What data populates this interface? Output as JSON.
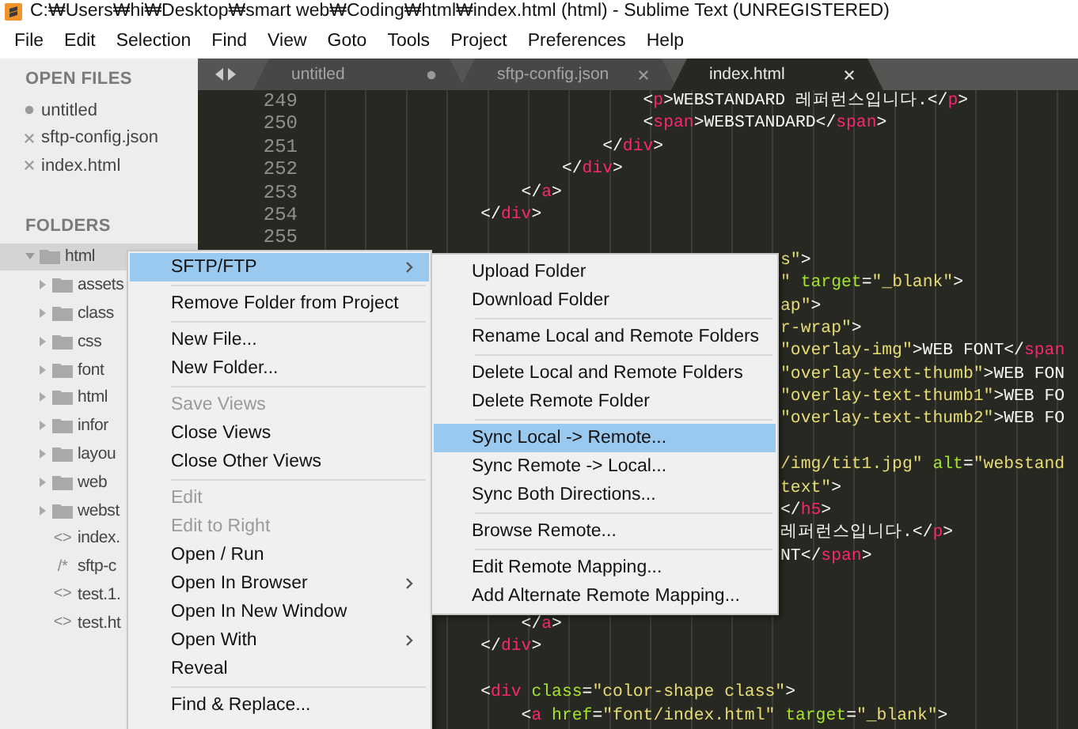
{
  "window": {
    "title": "C:₩Users₩hi₩Desktop₩smart web₩Coding₩html₩index.html (html) - Sublime Text (UNREGISTERED)"
  },
  "menu_bar": [
    {
      "label": "File"
    },
    {
      "label": "Edit"
    },
    {
      "label": "Selection"
    },
    {
      "label": "Find"
    },
    {
      "label": "View"
    },
    {
      "label": "Goto"
    },
    {
      "label": "Tools"
    },
    {
      "label": "Project"
    },
    {
      "label": "Preferences"
    },
    {
      "label": "Help"
    }
  ],
  "sidebar": {
    "open_files_header": "OPEN FILES",
    "open_files": [
      {
        "name": "untitled",
        "dirty": true
      },
      {
        "name": "sftp-config.json",
        "dirty": false
      },
      {
        "name": "index.html",
        "dirty": false
      }
    ],
    "folders_header": "FOLDERS",
    "folders": [
      {
        "name": "html",
        "kind": "folder",
        "expanded": true,
        "selected": true,
        "children": [
          {
            "name": "assets",
            "kind": "folder",
            "expanded": false,
            "selected": false
          },
          {
            "name": "class",
            "kind": "folder",
            "expanded": false,
            "selected": false
          },
          {
            "name": "css",
            "kind": "folder",
            "expanded": false,
            "selected": false
          },
          {
            "name": "font",
            "kind": "folder",
            "expanded": false,
            "selected": false
          },
          {
            "name": "html",
            "kind": "folder",
            "expanded": false,
            "selected": false
          },
          {
            "name": "infor",
            "kind": "folder",
            "expanded": false,
            "selected": false
          },
          {
            "name": "layou",
            "kind": "folder",
            "expanded": false,
            "selected": false
          },
          {
            "name": "web",
            "kind": "folder",
            "expanded": false,
            "selected": false
          },
          {
            "name": "webst",
            "kind": "folder",
            "expanded": false,
            "selected": false
          },
          {
            "name": "index.",
            "kind": "file",
            "glyph": "<>",
            "selected": false
          },
          {
            "name": "sftp-c",
            "kind": "file",
            "glyph": "/*",
            "selected": false
          },
          {
            "name": "test.1.",
            "kind": "file",
            "glyph": "<>",
            "selected": false
          },
          {
            "name": "test.ht",
            "kind": "file",
            "glyph": "<>",
            "selected": false
          }
        ]
      }
    ]
  },
  "tabs": [
    {
      "label": "untitled",
      "dirty": true,
      "selected": false
    },
    {
      "label": "sftp-config.json",
      "dirty": false,
      "selected": false
    },
    {
      "label": "index.html",
      "dirty": false,
      "selected": true
    }
  ],
  "editor": {
    "rows": [
      {
        "num": "249",
        "kind": "full",
        "segs": [
          {
            "text": "                                <",
            "kind": "plain"
          },
          {
            "text": "p",
            "kind": "tag"
          },
          {
            "text": ">WEBSTANDARD 레퍼런스입니다.</",
            "kind": "plain"
          },
          {
            "text": "p",
            "kind": "tag"
          },
          {
            "text": ">",
            "kind": "plain"
          }
        ]
      },
      {
        "num": "250",
        "kind": "full",
        "segs": [
          {
            "text": "                                <",
            "kind": "plain"
          },
          {
            "text": "span",
            "kind": "tag"
          },
          {
            "text": ">WEBSTANDARD</",
            "kind": "plain"
          },
          {
            "text": "span",
            "kind": "tag"
          },
          {
            "text": ">",
            "kind": "plain"
          }
        ]
      },
      {
        "num": "251",
        "kind": "full",
        "segs": [
          {
            "text": "                            </",
            "kind": "plain"
          },
          {
            "text": "div",
            "kind": "tag"
          },
          {
            "text": ">",
            "kind": "plain"
          }
        ]
      },
      {
        "num": "252",
        "kind": "full",
        "segs": [
          {
            "text": "                        </",
            "kind": "plain"
          },
          {
            "text": "div",
            "kind": "tag"
          },
          {
            "text": ">",
            "kind": "plain"
          }
        ]
      },
      {
        "num": "253",
        "kind": "full",
        "segs": [
          {
            "text": "                    </",
            "kind": "plain"
          },
          {
            "text": "a",
            "kind": "tag"
          },
          {
            "text": ">",
            "kind": "plain"
          }
        ]
      },
      {
        "num": "254",
        "kind": "full",
        "segs": [
          {
            "text": "                </",
            "kind": "plain"
          },
          {
            "text": "div",
            "kind": "tag"
          },
          {
            "text": ">",
            "kind": "plain"
          }
        ]
      },
      {
        "num": "255",
        "kind": "full"
      },
      {
        "kind": "fragment",
        "segs": [
          {
            "text": "s\"",
            "kind": "string"
          },
          {
            "text": ">",
            "kind": "plain"
          }
        ]
      },
      {
        "kind": "fragment",
        "segs": [
          {
            "text": "\"",
            "kind": "string"
          },
          {
            "text": " target",
            "kind": "attr"
          },
          {
            "text": "=",
            "kind": "plain"
          },
          {
            "text": "\"_blank\"",
            "kind": "string"
          },
          {
            "text": ">",
            "kind": "plain"
          }
        ]
      },
      {
        "kind": "fragment",
        "segs": [
          {
            "text": "ap\"",
            "kind": "string"
          },
          {
            "text": ">",
            "kind": "plain"
          }
        ]
      },
      {
        "kind": "fragment",
        "segs": [
          {
            "text": "r-wrap\"",
            "kind": "string"
          },
          {
            "text": ">",
            "kind": "plain"
          }
        ]
      },
      {
        "kind": "fragment",
        "segs": [
          {
            "text": "\"overlay-img\"",
            "kind": "string"
          },
          {
            "text": ">WEB FONT</",
            "kind": "plain"
          },
          {
            "text": "span",
            "kind": "tag"
          }
        ]
      },
      {
        "kind": "fragment",
        "segs": [
          {
            "text": "\"overlay-text-thumb\"",
            "kind": "string"
          },
          {
            "text": ">WEB FON",
            "kind": "plain"
          }
        ]
      },
      {
        "kind": "fragment",
        "segs": [
          {
            "text": "\"overlay-text-thumb1\"",
            "kind": "string"
          },
          {
            "text": ">WEB FO",
            "kind": "plain"
          }
        ]
      },
      {
        "kind": "fragment",
        "segs": [
          {
            "text": "\"overlay-text-thumb2\"",
            "kind": "string"
          },
          {
            "text": ">WEB FO",
            "kind": "plain"
          }
        ]
      },
      {
        "kind": "fragment"
      },
      {
        "kind": "fragment",
        "segs": [
          {
            "text": "/img/tit1.jpg\"",
            "kind": "string"
          },
          {
            "text": " alt",
            "kind": "attr"
          },
          {
            "text": "=",
            "kind": "plain"
          },
          {
            "text": "\"webstand",
            "kind": "string"
          }
        ]
      },
      {
        "kind": "fragment",
        "segs": [
          {
            "text": "text\"",
            "kind": "string"
          },
          {
            "text": ">",
            "kind": "plain"
          }
        ]
      },
      {
        "kind": "fragment",
        "segs": [
          {
            "text": "</",
            "kind": "plain"
          },
          {
            "text": "h5",
            "kind": "tag"
          },
          {
            "text": ">",
            "kind": "plain"
          }
        ]
      },
      {
        "kind": "fragment",
        "segs": [
          {
            "text": "레퍼런스입니다.</",
            "kind": "plain"
          },
          {
            "text": "p",
            "kind": "tag"
          },
          {
            "text": ">",
            "kind": "plain"
          }
        ]
      },
      {
        "kind": "fragment",
        "segs": [
          {
            "text": "NT</",
            "kind": "plain"
          },
          {
            "text": "span",
            "kind": "tag"
          },
          {
            "text": ">",
            "kind": "plain"
          }
        ]
      },
      {
        "kind": "hidden"
      },
      {
        "kind": "hidden"
      },
      {
        "kind": "full",
        "segs": [
          {
            "text": "                    </",
            "kind": "plain"
          },
          {
            "text": "a",
            "kind": "tag"
          },
          {
            "text": ">",
            "kind": "plain"
          }
        ]
      },
      {
        "kind": "full",
        "segs": [
          {
            "text": "                </",
            "kind": "plain"
          },
          {
            "text": "div",
            "kind": "tag"
          },
          {
            "text": ">",
            "kind": "plain"
          }
        ]
      },
      {
        "kind": "full"
      },
      {
        "kind": "full",
        "segs": [
          {
            "text": "                <",
            "kind": "plain"
          },
          {
            "text": "div",
            "kind": "tag"
          },
          {
            "text": " class",
            "kind": "attr"
          },
          {
            "text": "=",
            "kind": "plain"
          },
          {
            "text": "\"color-shape class\"",
            "kind": "string"
          },
          {
            "text": ">",
            "kind": "plain"
          }
        ]
      },
      {
        "kind": "full",
        "segs": [
          {
            "text": "                    <",
            "kind": "plain"
          },
          {
            "text": "a",
            "kind": "tag"
          },
          {
            "text": " href",
            "kind": "attr"
          },
          {
            "text": "=",
            "kind": "plain"
          },
          {
            "text": "\"font/index.html\"",
            "kind": "string"
          },
          {
            "text": " target",
            "kind": "attr"
          },
          {
            "text": "=",
            "kind": "plain"
          },
          {
            "text": "\"_blank\"",
            "kind": "string"
          },
          {
            "text": ">",
            "kind": "plain"
          }
        ]
      }
    ]
  },
  "context_menu": {
    "items": [
      {
        "kind": "item",
        "label": "SFTP/FTP",
        "selected": true,
        "disabled": false,
        "submenu": true
      },
      {
        "kind": "separator"
      },
      {
        "kind": "item",
        "label": "Remove Folder from Project",
        "selected": false,
        "disabled": false,
        "submenu": false
      },
      {
        "kind": "separator"
      },
      {
        "kind": "item",
        "label": "New File...",
        "selected": false,
        "disabled": false,
        "submenu": false
      },
      {
        "kind": "item",
        "label": "New Folder...",
        "selected": false,
        "disabled": false,
        "submenu": false
      },
      {
        "kind": "separator"
      },
      {
        "kind": "item",
        "label": "Save Views",
        "selected": false,
        "disabled": true,
        "submenu": false
      },
      {
        "kind": "item",
        "label": "Close Views",
        "selected": false,
        "disabled": false,
        "submenu": false
      },
      {
        "kind": "item",
        "label": "Close Other Views",
        "selected": false,
        "disabled": false,
        "submenu": false
      },
      {
        "kind": "separator"
      },
      {
        "kind": "item",
        "label": "Edit",
        "selected": false,
        "disabled": true,
        "submenu": false
      },
      {
        "kind": "item",
        "label": "Edit to Right",
        "selected": false,
        "disabled": true,
        "submenu": false
      },
      {
        "kind": "item",
        "label": "Open / Run",
        "selected": false,
        "disabled": false,
        "submenu": false
      },
      {
        "kind": "item",
        "label": "Open In Browser",
        "selected": false,
        "disabled": false,
        "submenu": true
      },
      {
        "kind": "item",
        "label": "Open In New Window",
        "selected": false,
        "disabled": false,
        "submenu": false
      },
      {
        "kind": "item",
        "label": "Open With",
        "selected": false,
        "disabled": false,
        "submenu": true
      },
      {
        "kind": "item",
        "label": "Reveal",
        "selected": false,
        "disabled": false,
        "submenu": false
      },
      {
        "kind": "separator"
      },
      {
        "kind": "item",
        "label": "Find & Replace...",
        "selected": false,
        "disabled": false,
        "submenu": false
      }
    ]
  },
  "submenu": {
    "items": [
      {
        "kind": "item",
        "label": "Upload Folder",
        "selected": false
      },
      {
        "kind": "item",
        "label": "Download Folder",
        "selected": false
      },
      {
        "kind": "separator"
      },
      {
        "kind": "item",
        "label": "Rename Local and Remote Folders",
        "selected": false
      },
      {
        "kind": "separator"
      },
      {
        "kind": "item",
        "label": "Delete Local and Remote Folders",
        "selected": false
      },
      {
        "kind": "item",
        "label": "Delete Remote Folder",
        "selected": false
      },
      {
        "kind": "separator"
      },
      {
        "kind": "item",
        "label": "Sync Local -> Remote...",
        "selected": true
      },
      {
        "kind": "item",
        "label": "Sync Remote -> Local...",
        "selected": false
      },
      {
        "kind": "item",
        "label": "Sync Both Directions...",
        "selected": false
      },
      {
        "kind": "separator"
      },
      {
        "kind": "item",
        "label": "Browse Remote...",
        "selected": false
      },
      {
        "kind": "separator"
      },
      {
        "kind": "item",
        "label": "Edit Remote Mapping...",
        "selected": false
      },
      {
        "kind": "item",
        "label": "Add Alternate Remote Mapping...",
        "selected": false
      }
    ]
  }
}
